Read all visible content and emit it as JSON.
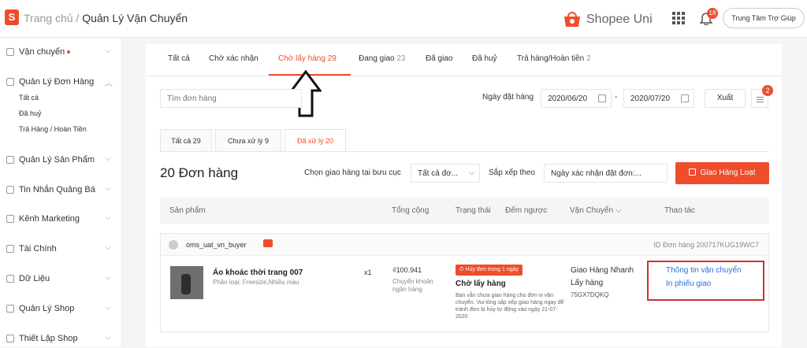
{
  "header": {
    "breadcrumb_home": "Trang chủ /",
    "breadcrumb_current": "Quản Lý Vận Chuyển",
    "logo_letter": "S",
    "brand_text": "Shopee Uni",
    "notification_count": "18",
    "help_label": "Trung Tâm Trợ Giúp",
    "icons": [
      "shopee-logo-icon",
      "shopee-uni-logo-icon",
      "apps-grid-icon",
      "bell-icon"
    ]
  },
  "sidebar": {
    "shipping": "Vận chuyển",
    "order_mgmt": "Quản Lý Đơn Hàng",
    "sub_all": "Tất cả",
    "sub_cancelled": "Đã huỷ",
    "sub_returns": "Trả Hàng / Hoàn Tiền",
    "products": "Quản Lý Sản Phẩm",
    "ads": "Tin Nhắn Quảng Bá",
    "marketing": "Kênh Marketing",
    "finance": "Tài Chính",
    "data": "Dữ Liệu",
    "shop": "Quản Lý Shop",
    "setup": "Thiết Lập Shop"
  },
  "tabs": {
    "all": "Tất cả",
    "to_confirm": "Chờ xác nhận",
    "to_pickup": "Chờ lấy hàng",
    "to_pickup_count": "29",
    "shipping": "Đang giao",
    "shipping_count": "23",
    "delivered": "Đã giao",
    "cancelled": "Đã huỷ",
    "returns": "Trả hàng/Hoàn tiền",
    "returns_count": "2"
  },
  "filters": {
    "search_placeholder": "Tìm đơn hàng",
    "date_label": "Ngày đặt hàng",
    "date_from": "2020/06/20",
    "date_sep": "-",
    "date_to": "2020/07/20",
    "export_label": "Xuất",
    "menu_badge": "2"
  },
  "subtabs": {
    "all": "Tất cả 29",
    "unprocessed": "Chưa xử lý 9",
    "processed": "Đã xử lý 20"
  },
  "toolbar": {
    "order_count": "20 Đơn hàng",
    "ship_label": "Chọn giao hàng tại bưu cục",
    "ship_value": "Tất cả đơ...",
    "sort_label": "Sắp xếp theo",
    "sort_value": "Ngày xác nhận đặt đơn:...",
    "bulk_button": "Giao Hàng Loạt"
  },
  "table": {
    "columns": [
      "Sản phẩm",
      "Tổng cộng",
      "Trạng thái",
      "Đếm ngược",
      "Vận Chuyển",
      "Thao tác"
    ]
  },
  "order": {
    "buyer": "oms_uat_vn_buyer",
    "order_id": "ID Đơn hàng 200717KUG19WC7",
    "product_name": "Áo khoác thời trang 007",
    "variation": "Phân loại: Freesize,Nhiều màu",
    "quantity": "x1",
    "price": "₫100.941",
    "payment": "Chuyển khoản ngân hàng",
    "urgent_badge": "Hủy đơn trong 1 ngày",
    "status": "Chờ lấy hàng",
    "status_desc": "Bạn vẫn chưa giao hàng cho đơn vị vận chuyển. Vui lòng sắp xếp giao hàng ngay để tránh đơn bị hủy tự động vào ngày 21-07-2020",
    "carrier": "Giao Hàng Nhanh",
    "pickup_label": "Lấy hàng",
    "tracking": "75GX7DQKQ",
    "action_shipping_info": "Thông tin vận chuyển",
    "action_print": "In phiếu giao"
  },
  "colors": {
    "accent": "#ee4d2d",
    "link": "#2673dd",
    "highlight_box": "#d32f2f"
  }
}
